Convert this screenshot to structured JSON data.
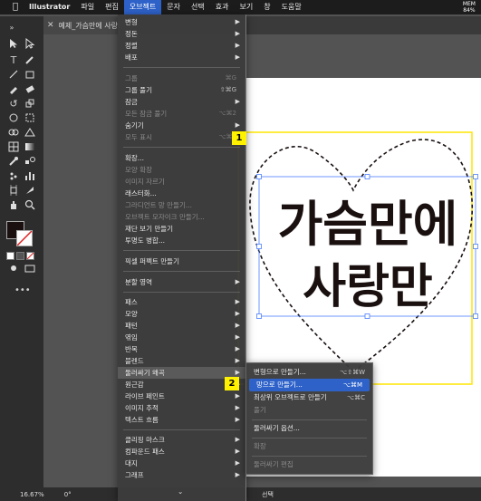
{
  "menubar": {
    "app_name": "Illustrator",
    "items": [
      "파일",
      "편집",
      "오브젝트",
      "문자",
      "선택",
      "효과",
      "보기",
      "창",
      "도움말"
    ],
    "mem_label": "MEM",
    "mem_value": "84%"
  },
  "document": {
    "tab_title": "예제_가슴만에 사랑만.",
    "zoom": "16.67%",
    "rotation": "0°",
    "selection_label": "선택"
  },
  "object_menu": {
    "items": [
      {
        "label": "변형",
        "shortcut": "",
        "submenu": true,
        "disabled": false
      },
      {
        "label": "정돈",
        "shortcut": "",
        "submenu": true,
        "disabled": false
      },
      {
        "label": "정렬",
        "shortcut": "",
        "submenu": true,
        "disabled": false
      },
      {
        "label": "배포",
        "shortcut": "",
        "submenu": true,
        "disabled": false
      },
      {
        "label": "그룹",
        "shortcut": "⌘G",
        "submenu": false,
        "disabled": true
      },
      {
        "label": "그룹 풀기",
        "shortcut": "⇧⌘G",
        "submenu": false,
        "disabled": false
      },
      {
        "label": "잠금",
        "shortcut": "",
        "submenu": true,
        "disabled": false
      },
      {
        "label": "모든 잠금 풀기",
        "shortcut": "⌥⌘2",
        "submenu": false,
        "disabled": true
      },
      {
        "label": "숨기기",
        "shortcut": "",
        "submenu": true,
        "disabled": false
      },
      {
        "label": "모두 표시",
        "shortcut": "⌥⌘3",
        "submenu": false,
        "disabled": true
      },
      {
        "label": "확장...",
        "shortcut": "",
        "submenu": false,
        "disabled": false
      },
      {
        "label": "모양 확장",
        "shortcut": "",
        "submenu": false,
        "disabled": true
      },
      {
        "label": "이미지 자르기",
        "shortcut": "",
        "submenu": false,
        "disabled": true
      },
      {
        "label": "래스터화...",
        "shortcut": "",
        "submenu": false,
        "disabled": false
      },
      {
        "label": "그라디언트 망 만들기...",
        "shortcut": "",
        "submenu": false,
        "disabled": true
      },
      {
        "label": "오브젝트 모자이크 만들기...",
        "shortcut": "",
        "submenu": false,
        "disabled": true
      },
      {
        "label": "재단 보기 만들기",
        "shortcut": "",
        "submenu": false,
        "disabled": false
      },
      {
        "label": "투명도 병합...",
        "shortcut": "",
        "submenu": false,
        "disabled": false
      },
      {
        "label": "픽셀 퍼펙트 만들기",
        "shortcut": "",
        "submenu": false,
        "disabled": false
      },
      {
        "label": "분할 영역",
        "shortcut": "",
        "submenu": true,
        "disabled": false
      },
      {
        "label": "패스",
        "shortcut": "",
        "submenu": true,
        "disabled": false
      },
      {
        "label": "모양",
        "shortcut": "",
        "submenu": true,
        "disabled": false
      },
      {
        "label": "패턴",
        "shortcut": "",
        "submenu": true,
        "disabled": false
      },
      {
        "label": "엮임",
        "shortcut": "",
        "submenu": true,
        "disabled": false
      },
      {
        "label": "반복",
        "shortcut": "",
        "submenu": true,
        "disabled": false
      },
      {
        "label": "블렌드",
        "shortcut": "",
        "submenu": true,
        "disabled": false
      },
      {
        "label": "둘러싸기 왜곡",
        "shortcut": "",
        "submenu": true,
        "disabled": false
      },
      {
        "label": "원근감",
        "shortcut": "",
        "submenu": true,
        "disabled": false
      },
      {
        "label": "라이브 페인트",
        "shortcut": "",
        "submenu": true,
        "disabled": false
      },
      {
        "label": "이미지 추적",
        "shortcut": "",
        "submenu": true,
        "disabled": false
      },
      {
        "label": "텍스트 흐름",
        "shortcut": "",
        "submenu": true,
        "disabled": false
      },
      {
        "label": "클리핑 마스크",
        "shortcut": "",
        "submenu": true,
        "disabled": false
      },
      {
        "label": "컴파운드 패스",
        "shortcut": "",
        "submenu": true,
        "disabled": false
      },
      {
        "label": "대지",
        "shortcut": "",
        "submenu": true,
        "disabled": false
      },
      {
        "label": "그래프",
        "shortcut": "",
        "submenu": true,
        "disabled": false
      }
    ]
  },
  "envelope_submenu": {
    "items": [
      {
        "label": "변형으로 만들기...",
        "shortcut": "⌥⇧⌘W",
        "disabled": false,
        "selected": false
      },
      {
        "label": "망으로 만들기...",
        "shortcut": "⌥⌘M",
        "disabled": false,
        "selected": true
      },
      {
        "label": "최상위 오브젝트로 만들기",
        "shortcut": "⌥⌘C",
        "disabled": false,
        "selected": false
      },
      {
        "label": "풀기",
        "shortcut": "",
        "disabled": true,
        "selected": false
      },
      {
        "label": "둘러싸기 옵션...",
        "shortcut": "",
        "disabled": false,
        "selected": false
      },
      {
        "label": "확장",
        "shortcut": "",
        "disabled": true,
        "selected": false
      },
      {
        "label": "둘러싸기 편집",
        "shortcut": "",
        "disabled": true,
        "selected": false
      }
    ]
  },
  "artwork": {
    "line1": "가슴만에",
    "line2": "사랑만"
  },
  "badges": [
    "1",
    "2"
  ],
  "colors": {
    "menu_selected": "#2e62c9",
    "badge": "#fff200",
    "selection_box": "#4a7dff",
    "artwork": "#1a1010"
  }
}
